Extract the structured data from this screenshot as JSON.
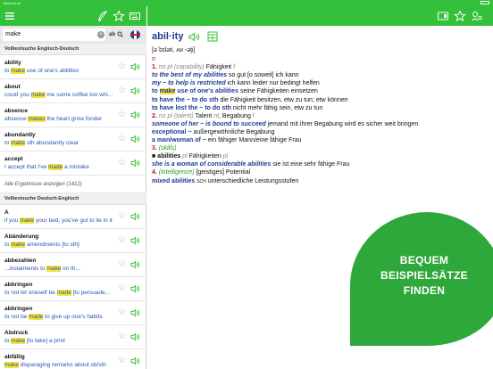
{
  "status_bar": {
    "carrier": "Telekom.de",
    "time": ""
  },
  "left_toolbar": {
    "icons": [
      "menu-icon",
      "pen-icon",
      "star-icon",
      "keyboard-icon"
    ]
  },
  "search": {
    "value": "make",
    "ab_label": "ab",
    "language": "EN→DE"
  },
  "sections": [
    {
      "title": "Volltextsuche Englisch-Deutsch",
      "rows": [
        {
          "headword": "ability",
          "before": "to ",
          "hl": "make",
          "after": " use of one's abilities"
        },
        {
          "headword": "about",
          "before": "could you ",
          "hl": "make",
          "after": " me some coffee too whi..."
        },
        {
          "headword": "absence",
          "before": "absence ",
          "hl": "makes",
          "after": " the heart grow fonder"
        },
        {
          "headword": "abundantly",
          "before": "to ",
          "hl": "make",
          "after": " sth abundantly clear"
        },
        {
          "headword": "accept",
          "before": "I accept that I've ",
          "hl": "made",
          "after": " a mistake"
        }
      ],
      "more": "Alle Ergebnisse anzeigen (1412)"
    },
    {
      "title": "Volltextsuche Deutsch-Englisch",
      "rows": [
        {
          "headword": "A",
          "before": "if you ",
          "hl": "make",
          "after": " your bed, you've got to lie in it"
        },
        {
          "headword": "Abänderung",
          "before": "to ",
          "hl": "make",
          "after": " amendments [to sth]"
        },
        {
          "headword": "abbezahlen",
          "before": "...instalments to ",
          "hl": "make",
          "after": " on th..."
        },
        {
          "headword": "abbringen",
          "before": "to not let oneself be ",
          "hl": "made",
          "after": " [to persuade..."
        },
        {
          "headword": "abbringen",
          "before": "to not be ",
          "hl": "made",
          "after": " to give up one's habits"
        },
        {
          "headword": "Abdruck",
          "before": "to ",
          "hl": "make",
          "after": " [to take] a print"
        },
        {
          "headword": "abfällig",
          "before": "",
          "hl": "make",
          "after": " disparaging remarks about sb/sth"
        }
      ]
    }
  ],
  "entry": {
    "headword": "abil·ity",
    "pron": "[əˈbɪləti,",
    "pron_am_label": "AM",
    "pron_am": "-ət̬i]",
    "pos": "n",
    "s1_num": "1.",
    "s1_label": "no pl (capability)",
    "s1_trans": "Fähigkeit",
    "s1_gender": "f",
    "p1_phrase": "to the best of my abilities",
    "p1_trans": "so gut [o soweit] ich kann",
    "p2_phrase": "my ~ to help is restricted",
    "p2_trans": "ich kann leider nur bedingt helfen",
    "p3_phrase_pre": "to ",
    "p3_phrase_hl": "make",
    "p3_phrase_post": " use of one's abilities",
    "p3_trans": "seine Fähigkeiten einsetzen",
    "p4_phrase": "to have the ~ to do sth",
    "p4_trans": "die Fähigkeit besitzen, etw zu tun; etw können",
    "p5_phrase": "to have lost the ~ to do sth",
    "p5_trans": "nicht mehr fähig sein, etw zu tun",
    "s2_num": "2.",
    "s2_label": "no pl (talent)",
    "s2_trans": "Talent",
    "s2_gender": "nt",
    "s2_trans2": ", Begabung",
    "s2_gender2": "f",
    "p6_phrase": "someone of her ~ is bound to succeed",
    "p6_trans": "jemand mit ihrer Begabung wird es sicher weit bringen",
    "p7_phrase": "exceptional ~",
    "p7_trans": "außergewöhnliche Begabung",
    "p8_phrase": "a man/woman of ~",
    "p8_trans": "ein fähiger Mann/eine fähige Frau",
    "s3_num": "3.",
    "s3_label": "(skills)",
    "s3_bullet": "■ abilities",
    "s3_pl": "pl",
    "s3_trans": "Fähigkeiten",
    "s3_gender": "pl",
    "p9_phrase": "she is a woman of considerable abilities",
    "p9_trans": "sie ist eine sehr fähige Frau",
    "s4_num": "4.",
    "s4_label": "(intelligence)",
    "s4_trans": "[geistiges] Potential",
    "p10_phrase": "mixed abilities",
    "p10_region": "SCH",
    "p10_trans": "unterschiedliche Leistungsstufen"
  },
  "promo": {
    "line1": "BEQUEM",
    "line2": "BEISPIELSÄTZE",
    "line3": "FINDEN"
  },
  "colors": {
    "brand_green": "#35c03b",
    "highlight": "#f7e53a",
    "entry_blue": "#1f3a93",
    "sense_red": "#c0161a"
  }
}
